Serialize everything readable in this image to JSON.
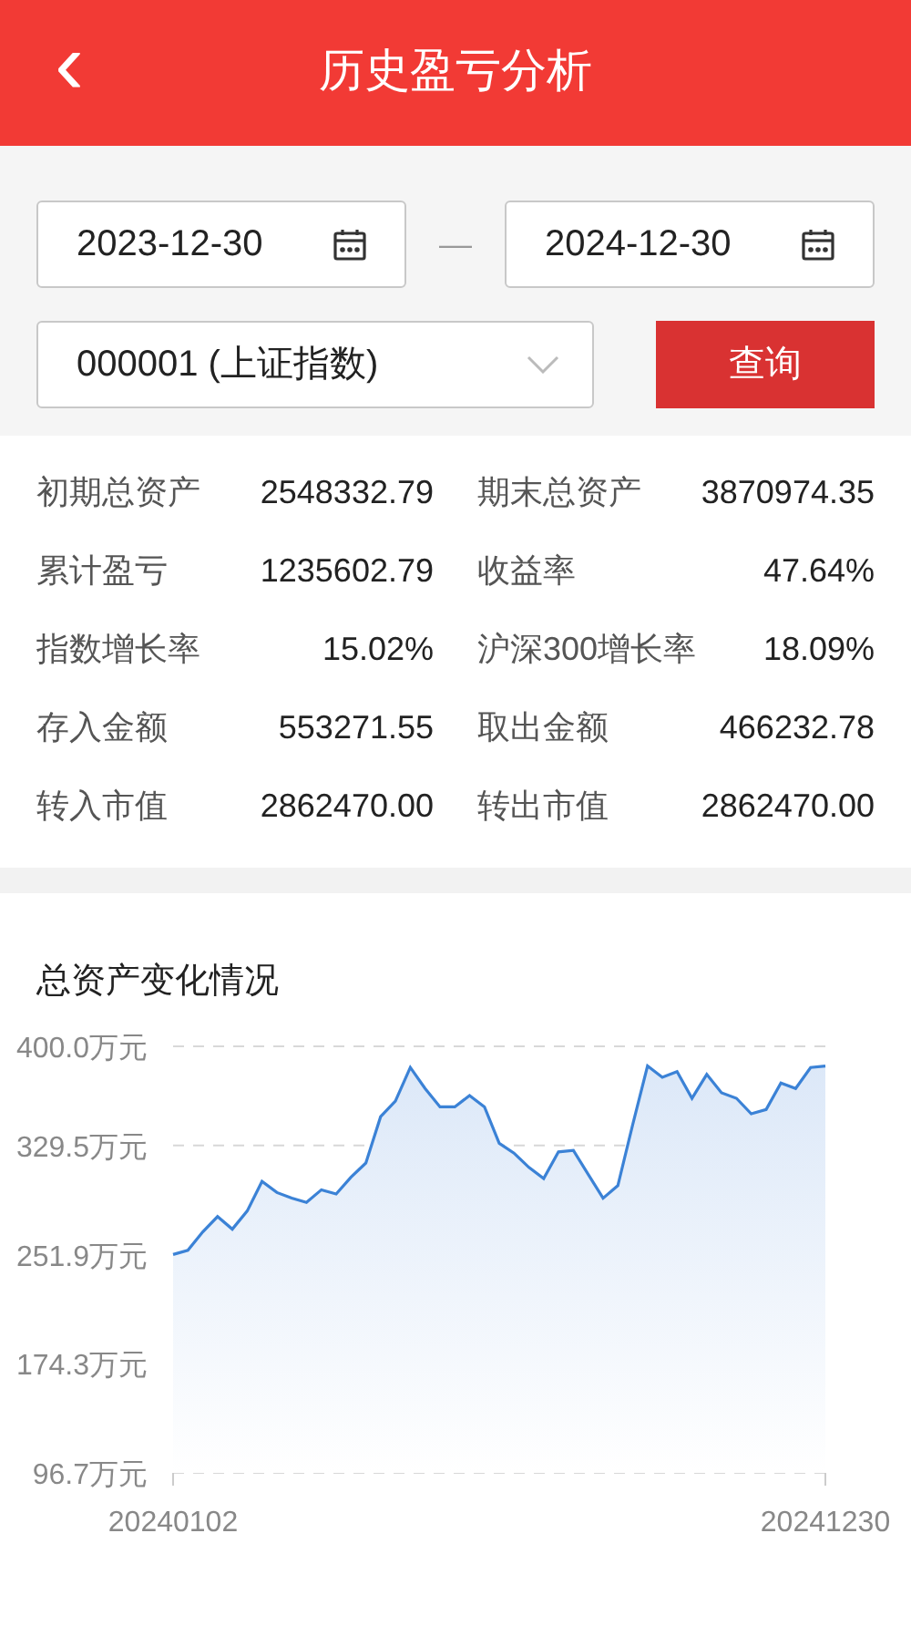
{
  "header": {
    "back_icon": "‹",
    "title": "历史盈亏分析"
  },
  "query": {
    "start_date": "2023-12-30",
    "separator": "—",
    "end_date": "2024-12-30",
    "index_select": "000001 (上证指数)",
    "submit": "查询"
  },
  "stats": [
    {
      "label": "初期总资产",
      "value": "2548332.79"
    },
    {
      "label": "期末总资产",
      "value": "3870974.35"
    },
    {
      "label": "累计盈亏",
      "value": "1235602.79"
    },
    {
      "label": "收益率",
      "value": "47.64%"
    },
    {
      "label": "指数增长率",
      "value": "15.02%"
    },
    {
      "label": "沪深300增长率",
      "value": "18.09%"
    },
    {
      "label": "存入金额",
      "value": "553271.55"
    },
    {
      "label": "取出金额",
      "value": "466232.78"
    },
    {
      "label": "转入市值",
      "value": "2862470.00"
    },
    {
      "label": "转出市值",
      "value": "2862470.00"
    }
  ],
  "chart_section": {
    "title": "总资产变化情况",
    "chart_data": {
      "type": "area",
      "ylim": [
        96.7,
        400
      ],
      "categories": [
        "20240102",
        null,
        null,
        null,
        null,
        null,
        null,
        null,
        null,
        null,
        null,
        null,
        null,
        null,
        null,
        null,
        null,
        null,
        null,
        null,
        null,
        null,
        null,
        null,
        null,
        null,
        null,
        null,
        null,
        null,
        null,
        null,
        null,
        null,
        null,
        null,
        null,
        null,
        null,
        null,
        null,
        null,
        null,
        null,
        "20241230"
      ],
      "yticks": [
        {
          "value": 96.7,
          "label": "96.7万元"
        },
        {
          "value": 174.3,
          "label": "174.3万元"
        },
        {
          "value": 251.9,
          "label": "251.9万元"
        },
        {
          "value": 329.5,
          "label": "329.5万元"
        },
        {
          "value": 400,
          "label": "400.0万元"
        }
      ],
      "series": [
        {
          "color": "#3b82d6",
          "values": [
            252,
            255,
            268,
            279,
            270,
            283,
            304,
            296,
            292,
            289,
            298,
            295,
            307,
            317,
            350,
            361,
            385,
            370,
            357,
            357,
            365,
            357,
            331,
            324,
            314,
            306,
            325,
            326,
            309,
            292,
            301,
            344,
            386,
            378,
            382,
            363,
            380,
            367,
            363,
            352,
            355,
            374,
            370,
            385,
            386
          ]
        }
      ]
    }
  }
}
